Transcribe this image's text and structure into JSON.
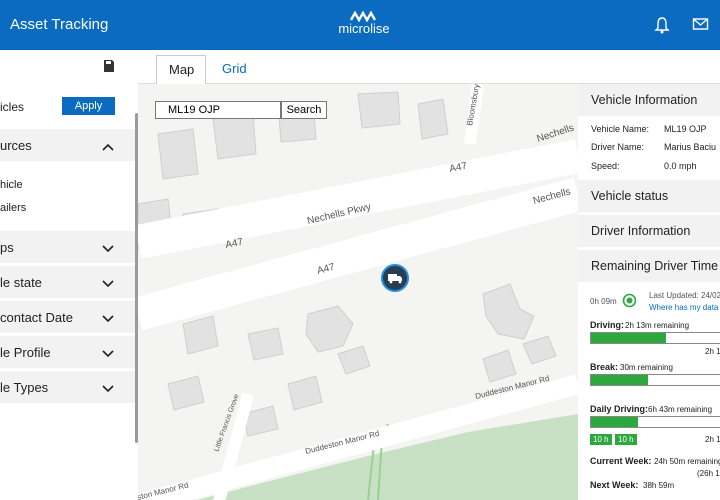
{
  "header": {
    "app_title": "Asset Tracking",
    "brand": "microlise",
    "bell_icon": "bell-icon",
    "mail_icon": "mail-icon"
  },
  "sidebar": {
    "save_icon": "save-icon",
    "apply_label": "icles",
    "apply_button": "Apply",
    "sections": [
      {
        "label": "urces",
        "icon": "chevron-up-icon"
      },
      {
        "label": "ps",
        "icon": "chevron-down-icon"
      },
      {
        "label": "le state",
        "icon": "chevron-down-icon"
      },
      {
        "label": "contact Date",
        "icon": "chevron-down-icon"
      },
      {
        "label": "le Profile",
        "icon": "chevron-down-icon"
      },
      {
        "label": "le Types",
        "icon": "chevron-down-icon"
      }
    ],
    "sub_items": [
      "hicle",
      "ailers"
    ]
  },
  "tabs": {
    "map": "Map",
    "grid": "Grid"
  },
  "map": {
    "search_value": "ML19 OJP",
    "search_button": "Search",
    "roads": [
      "A47",
      "A47",
      "A47",
      "Nechells Pkwy",
      "Nechells",
      "Nechells",
      "Bloomsbury S",
      "Duddeston Manor Rd",
      "Duddeston Manor Rd",
      "ston Manor Rd",
      "Little Francis Grove"
    ],
    "vehicle_icon": "truck-icon"
  },
  "panel": {
    "vehicle_info_title": "Vehicle Information",
    "vehicle_name_label": "Vehicle Name:",
    "vehicle_name": "ML19 OJP",
    "driver_name_label": "Driver Name:",
    "driver_name": "Marius Baciu",
    "speed_label": "Speed:",
    "speed": "0.0 mph",
    "vehicle_status_title": "Vehicle status",
    "driver_info_title": "Driver Information",
    "remaining_title": "Remaining Driver Time",
    "elapsed": "0h 09m",
    "last_updated": "Last Updated: 24/02",
    "where_data": "Where has my data c",
    "driving_label": "Driving:",
    "driving_remaining": "2h 13m remaining",
    "driving_fill": 0.54,
    "driving_end": "2h 1",
    "break_label": "Break:",
    "break_remaining": "30m remaining",
    "break_fill": 0.41,
    "daily_label": "Daily Driving:",
    "daily_remaining": "6h 43m remaining",
    "daily_fill": 0.34,
    "badge1": "10 h",
    "badge2": "10 h",
    "daily_end": "2h 1",
    "week_label": "Current Week:",
    "week_remaining": "24h 50m remaining",
    "week_sub": "(26h 1",
    "next_label": "Next Week:",
    "next_value": "38h 59m"
  }
}
